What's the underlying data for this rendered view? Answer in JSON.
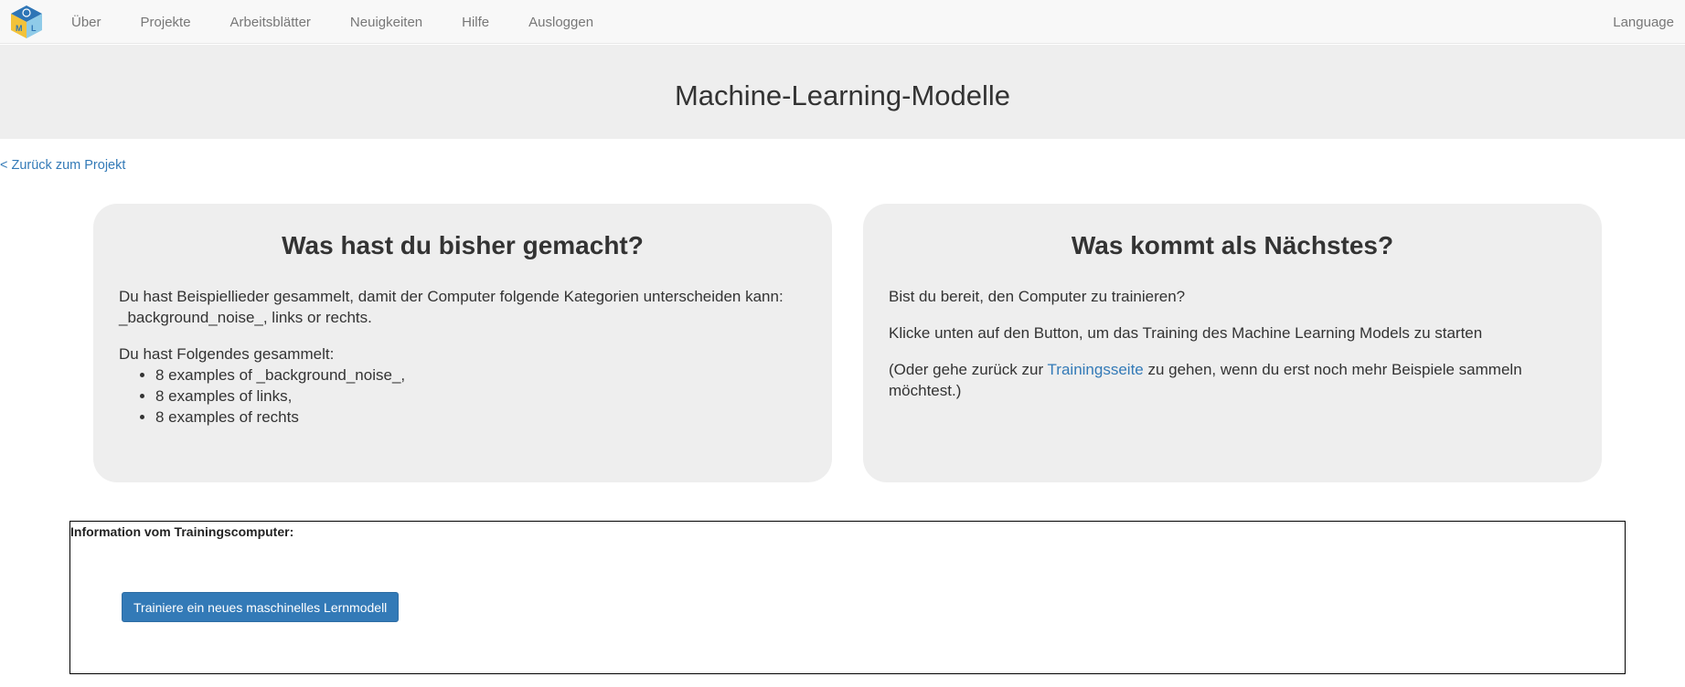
{
  "nav": {
    "logo_icon": "ml4k-cube-logo-icon",
    "items": [
      "Über",
      "Projekte",
      "Arbeitsblätter",
      "Neuigkeiten",
      "Hilfe",
      "Ausloggen"
    ],
    "language": "Language"
  },
  "header": {
    "title": "Machine-Learning-Modelle"
  },
  "back_link": "< Zurück zum Projekt",
  "left_panel": {
    "heading": "Was hast du bisher gemacht?",
    "intro": "Du hast Beispiellieder gesammelt, damit der Computer folgende Kategorien unterscheiden kann: _background_noise_, links or rechts.",
    "collected_label": "Du hast Folgendes gesammelt:",
    "items": [
      "8 examples of _background_noise_,",
      "8 examples of links,",
      "8 examples of rechts"
    ]
  },
  "right_panel": {
    "heading": "Was kommt als Nächstes?",
    "question": "Bist du bereit, den Computer zu trainieren?",
    "instruction": "Klicke unten auf den Button, um das Training des Machine Learning Models zu starten",
    "note_prefix": "(Oder gehe zurück zur ",
    "note_link": "Trainingsseite",
    "note_suffix": " zu gehen, wenn du erst noch mehr Beispiele sammeln möchtest.)"
  },
  "info": {
    "label": "Information vom Trainingscomputer:",
    "button_label": "Trainiere ein neues maschinelles Lernmodell"
  },
  "colors": {
    "link": "#337ab7",
    "primary_button": "#337ab7",
    "panel_bg": "#eeeeee",
    "navbar_bg": "#f8f8f8"
  }
}
